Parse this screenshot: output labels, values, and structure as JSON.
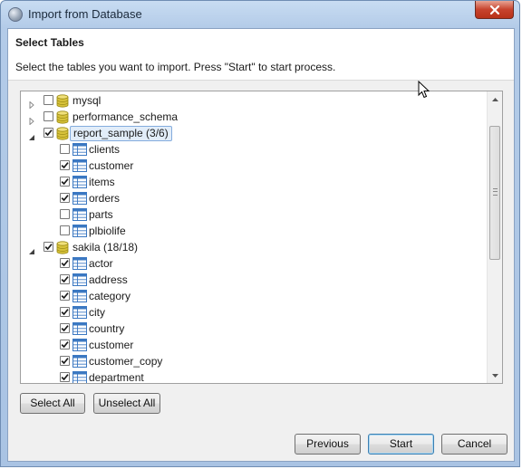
{
  "window": {
    "title": "Import from Database"
  },
  "header": {
    "title": "Select Tables",
    "description": "Select the tables you want to import. Press \"Start\" to start process."
  },
  "tree": {
    "rows": [
      {
        "level": 0,
        "expanded": false,
        "checked": false,
        "kind": "database",
        "label": "mysql"
      },
      {
        "level": 0,
        "expanded": false,
        "checked": false,
        "kind": "database",
        "label": "performance_schema"
      },
      {
        "level": 0,
        "expanded": true,
        "checked": true,
        "kind": "database",
        "label": "report_sample (3/6)",
        "selected": true
      },
      {
        "level": 1,
        "checked": false,
        "kind": "table",
        "label": "clients"
      },
      {
        "level": 1,
        "checked": true,
        "kind": "table",
        "label": "customer"
      },
      {
        "level": 1,
        "checked": true,
        "kind": "table",
        "label": "items"
      },
      {
        "level": 1,
        "checked": true,
        "kind": "table",
        "label": "orders"
      },
      {
        "level": 1,
        "checked": false,
        "kind": "table",
        "label": "parts"
      },
      {
        "level": 1,
        "checked": false,
        "kind": "table",
        "label": "plbiolife"
      },
      {
        "level": 0,
        "expanded": true,
        "checked": true,
        "kind": "database",
        "label": "sakila (18/18)"
      },
      {
        "level": 1,
        "checked": true,
        "kind": "table",
        "label": "actor"
      },
      {
        "level": 1,
        "checked": true,
        "kind": "table",
        "label": "address"
      },
      {
        "level": 1,
        "checked": true,
        "kind": "table",
        "label": "category"
      },
      {
        "level": 1,
        "checked": true,
        "kind": "table",
        "label": "city"
      },
      {
        "level": 1,
        "checked": true,
        "kind": "table",
        "label": "country"
      },
      {
        "level": 1,
        "checked": true,
        "kind": "table",
        "label": "customer"
      },
      {
        "level": 1,
        "checked": true,
        "kind": "table",
        "label": "customer_copy"
      },
      {
        "level": 1,
        "checked": true,
        "kind": "table",
        "label": "department"
      }
    ]
  },
  "selection_buttons": {
    "select_all": "Select All",
    "unselect_all": "Unselect All"
  },
  "footer": {
    "previous": "Previous",
    "start": "Start",
    "cancel": "Cancel"
  },
  "colors": {
    "database_icon": "#d7c23a",
    "table_icon": "#3b78c2",
    "selection": "#e2edf9"
  }
}
